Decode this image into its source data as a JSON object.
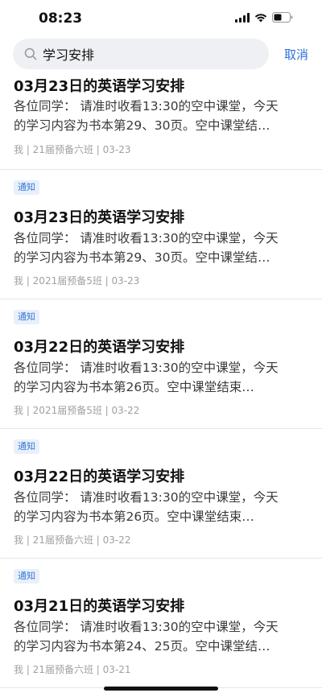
{
  "status_bar": {
    "time": "08:23"
  },
  "search": {
    "query": "学习安排",
    "cancel_label": "取消"
  },
  "results": [
    {
      "tag": "",
      "title": "03月23日的英语学习安排",
      "line1": "各位同学： 请准时收看13:30的空中课堂，今天",
      "line2": "的学习内容为书本第29、30页。空中课堂结…",
      "meta": "我 | 21届预备六班 | 03-23"
    },
    {
      "tag": "通知",
      "title": "03月23日的英语学习安排",
      "line1": "各位同学： 请准时收看13:30的空中课堂，今天",
      "line2": "的学习内容为书本第29、30页。空中课堂结…",
      "meta": "我 | 2021届预备5班 | 03-23"
    },
    {
      "tag": "通知",
      "title": "03月22日的英语学习安排",
      "line1": "各位同学： 请准时收看13:30的空中课堂，今天",
      "line2": "的学习内容为书本第26页。空中课堂结束…",
      "meta": "我 | 2021届预备5班 | 03-22"
    },
    {
      "tag": "通知",
      "title": "03月22日的英语学习安排",
      "line1": "各位同学： 请准时收看13:30的空中课堂，今天",
      "line2": "的学习内容为书本第26页。空中课堂结束…",
      "meta": "我 | 21届预备六班 | 03-22"
    },
    {
      "tag": "通知",
      "title": "03月21日的英语学习安排",
      "line1": "各位同学： 请准时收看13:30的空中课堂，今天",
      "line2": "的学习内容为书本第24、25页。空中课堂结…",
      "meta": "我 | 21届预备六班 | 03-21"
    }
  ],
  "colors": {
    "accent": "#2f6fd8",
    "tag_bg": "#e8f0fb",
    "tag_text": "#3a77d4",
    "meta": "#a0a0a0"
  }
}
